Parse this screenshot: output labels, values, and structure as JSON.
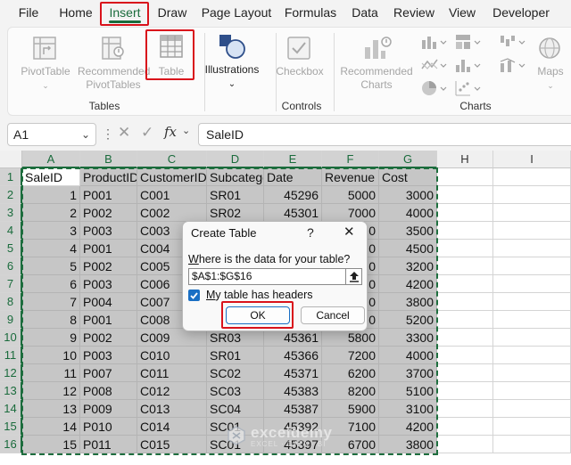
{
  "menu": {
    "items": [
      "File",
      "Home",
      "Insert",
      "Draw",
      "Page Layout",
      "Formulas",
      "Data",
      "Review",
      "View",
      "Developer"
    ],
    "active": "Insert"
  },
  "ribbon": {
    "buttons": {
      "pivot_table": "PivotTable",
      "recommended_pivot_line1": "Recommended",
      "recommended_pivot_line2": "PivotTables",
      "table": "Table",
      "illustrations": "Illustrations",
      "checkbox": "Checkbox",
      "recommended_charts_line1": "Recommended",
      "recommended_charts_line2": "Charts",
      "maps": "Maps"
    },
    "groups": {
      "tables": "Tables",
      "controls": "Controls",
      "charts": "Charts"
    },
    "icons": {
      "pivot_table": "pivot-table-icon",
      "recommended_pivot": "recommended-pivot-icon",
      "table": "table-icon",
      "illustrations": "shapes-icon",
      "checkbox": "checkbox-icon",
      "recommended_charts": "recommended-charts-icon",
      "maps": "globe-icon"
    }
  },
  "formula_bar": {
    "name_box": "A1",
    "content": "SaleID",
    "fx_label": "fx"
  },
  "sheet": {
    "columns": [
      "A",
      "B",
      "C",
      "D",
      "E",
      "F",
      "G",
      "H",
      "I"
    ],
    "rows": [
      "1",
      "2",
      "3",
      "4",
      "5",
      "6",
      "7",
      "8",
      "9",
      "10",
      "11",
      "12",
      "13",
      "14",
      "15",
      "16"
    ],
    "headers": [
      "SaleID",
      "ProductID",
      "CustomerID",
      "Subcatego",
      "Date",
      "Revenue",
      "Cost"
    ],
    "data": [
      [
        "1",
        "P001",
        "C001",
        "SR01",
        "45296",
        "5000",
        "3000"
      ],
      [
        "2",
        "P002",
        "C002",
        "SR02",
        "45301",
        "7000",
        "4000"
      ],
      [
        "3",
        "P003",
        "C003",
        "",
        "",
        "0",
        "3500"
      ],
      [
        "4",
        "P001",
        "C004",
        "",
        "",
        "0",
        "4500"
      ],
      [
        "5",
        "P002",
        "C005",
        "",
        "",
        "0",
        "3200"
      ],
      [
        "6",
        "P003",
        "C006",
        "",
        "",
        "0",
        "4200"
      ],
      [
        "7",
        "P004",
        "C007",
        "",
        "",
        "0",
        "3800"
      ],
      [
        "8",
        "P001",
        "C008",
        "",
        "",
        "0",
        "5200"
      ],
      [
        "9",
        "P002",
        "C009",
        "SR03",
        "45361",
        "5800",
        "3300"
      ],
      [
        "10",
        "P003",
        "C010",
        "SR01",
        "45366",
        "7200",
        "4000"
      ],
      [
        "11",
        "P007",
        "C011",
        "SC02",
        "45371",
        "6200",
        "3700"
      ],
      [
        "12",
        "P008",
        "C012",
        "SC03",
        "45383",
        "8200",
        "5100"
      ],
      [
        "13",
        "P009",
        "C013",
        "SC04",
        "45387",
        "5900",
        "3100"
      ],
      [
        "14",
        "P010",
        "C014",
        "SC01",
        "45392",
        "7100",
        "4200"
      ],
      [
        "15",
        "P011",
        "C015",
        "SC01",
        "45397",
        "6700",
        "3800"
      ]
    ]
  },
  "dialog": {
    "title": "Create Table",
    "help": "?",
    "close": "✕",
    "prompt_underlined": "W",
    "prompt_rest": "here is the data for your table?",
    "range": "$A$1:$G$16",
    "checkbox_underlined": "M",
    "checkbox_rest": "y table has headers",
    "checked": true,
    "ok": "OK",
    "cancel": "Cancel"
  },
  "watermark": {
    "name": "exceldemy",
    "tagline": "EXCEL · DATA · BI"
  },
  "colors": {
    "accent": "#1a6b3c",
    "highlight": "#d9121b",
    "selection": "#c6c6c6",
    "check": "#1a6fc4"
  }
}
